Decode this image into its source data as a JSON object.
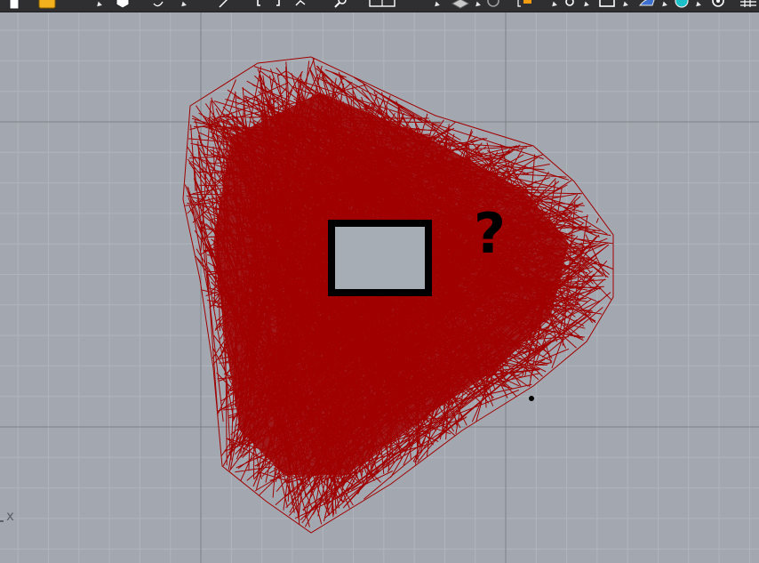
{
  "toolbar": {
    "tools": [
      {
        "name": "new-file-icon",
        "color": "#ffffff"
      },
      {
        "name": "open-folder-icon",
        "color": "#f3b21d"
      },
      {
        "name": "cursor-icon",
        "color": "#ffffff"
      },
      {
        "name": "fill-icon",
        "color": "#ffffff"
      },
      {
        "name": "curve-icon",
        "color": "#ffffff"
      },
      {
        "name": "line-icon",
        "color": "#ffffff"
      },
      {
        "name": "polyline-icon",
        "color": "#ffffff"
      },
      {
        "name": "bracket-icon",
        "color": "#ffffff"
      },
      {
        "name": "arrow-icon",
        "color": "#ffffff"
      },
      {
        "name": "magnifier-icon",
        "color": "#ffffff"
      },
      {
        "name": "view-layout-icon",
        "color": "#ffffff"
      },
      {
        "name": "render-icon",
        "color": "#ffffff"
      },
      {
        "name": "box-icon",
        "color": "#ffffff"
      },
      {
        "name": "circle-icon",
        "color": "#ffffff"
      },
      {
        "name": "layer-icon",
        "color": "#f39c12"
      },
      {
        "name": "pin-icon",
        "color": "#ffffff"
      },
      {
        "name": "rectangle-icon",
        "color": "#ffffff"
      },
      {
        "name": "paint-icon",
        "color": "#3c6fd0"
      },
      {
        "name": "globe-icon",
        "color": "#1bc0c8"
      },
      {
        "name": "gear-icon",
        "color": "#ffffff"
      },
      {
        "name": "grid-icon",
        "color": "#ffffff"
      }
    ]
  },
  "viewport": {
    "background_color": "#a3a8b0",
    "grid_minor_color": "#b0b5bc",
    "grid_major_color": "#7d8289",
    "scribble_color": "#a00000",
    "axis_label": "x",
    "annotation_text": "?",
    "annotation_color": "#000000",
    "rectangle_fill": "#a7adb5",
    "rectangle_stroke": "#000000"
  }
}
